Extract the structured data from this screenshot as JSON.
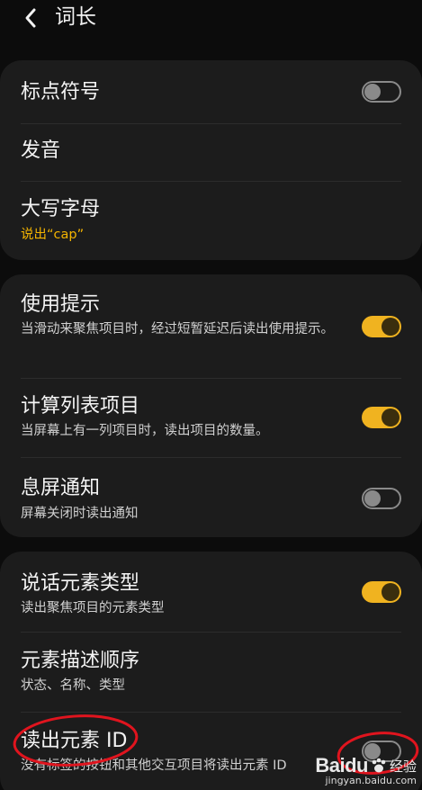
{
  "header": {
    "title": "词长"
  },
  "sections": [
    {
      "items": [
        {
          "title": "标点符号",
          "toggle": "off"
        },
        {
          "title": "发音"
        },
        {
          "title": "大写字母",
          "subtitle": "说出“cap”"
        }
      ]
    },
    {
      "items": [
        {
          "title": "使用提示",
          "subtitle": "当滑动来聚焦项目时，经过短暂延迟后读出使用提示。",
          "toggle": "on"
        },
        {
          "title": "计算列表项目",
          "subtitle": "当屏幕上有一列项目时，读出项目的数量。",
          "toggle": "on"
        },
        {
          "title": "息屏通知",
          "subtitle": "屏幕关闭时读出通知",
          "toggle": "off"
        }
      ]
    },
    {
      "items": [
        {
          "title": "说话元素类型",
          "subtitle": "读出聚焦项目的元素类型",
          "toggle": "on"
        },
        {
          "title": "元素描述顺序",
          "subtitle": "状态、名称、类型"
        },
        {
          "title": "读出元素 ID",
          "subtitle": "没有标签的按钮和其他交互项目将读出元素 ID",
          "toggle": "off"
        }
      ]
    }
  ],
  "colors": {
    "background": "#0c0c0c",
    "card": "#1c1c1c",
    "accent": "#f0b320",
    "annotation": "#e0141e"
  },
  "icons": {
    "back": "chevron-left-icon"
  },
  "watermark": {
    "brand": "Baidu",
    "suffix": "经验",
    "url": "jingyan.baidu.com"
  }
}
